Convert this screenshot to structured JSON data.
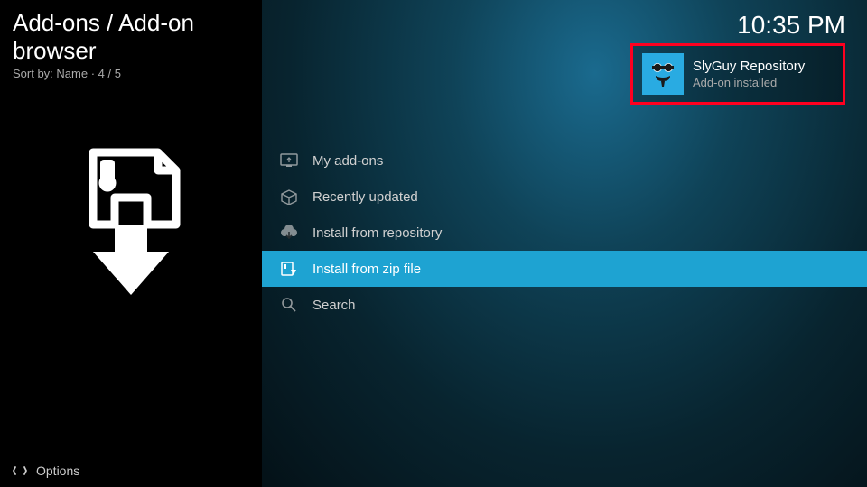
{
  "header": {
    "breadcrumb": "Add-ons / Add-on browser",
    "sort_label": "Sort by: Name  ·  4 / 5",
    "clock": "10:35 PM"
  },
  "menu": {
    "items": [
      {
        "label": "My add-ons",
        "icon": "my-addons-icon"
      },
      {
        "label": "Recently updated",
        "icon": "box-icon"
      },
      {
        "label": "Install from repository",
        "icon": "cloud-download-icon"
      },
      {
        "label": "Install from zip file",
        "icon": "zip-file-icon"
      },
      {
        "label": "Search",
        "icon": "search-icon"
      }
    ],
    "selected_index": 3
  },
  "notification": {
    "title": "SlyGuy Repository",
    "subtitle": "Add-on installed",
    "icon_name": "slyguy-icon"
  },
  "footer": {
    "options_label": "Options"
  },
  "colors": {
    "accent": "#1ea3d2",
    "highlight_border": "#ff0020",
    "notif_icon_bg": "#29abe2"
  }
}
